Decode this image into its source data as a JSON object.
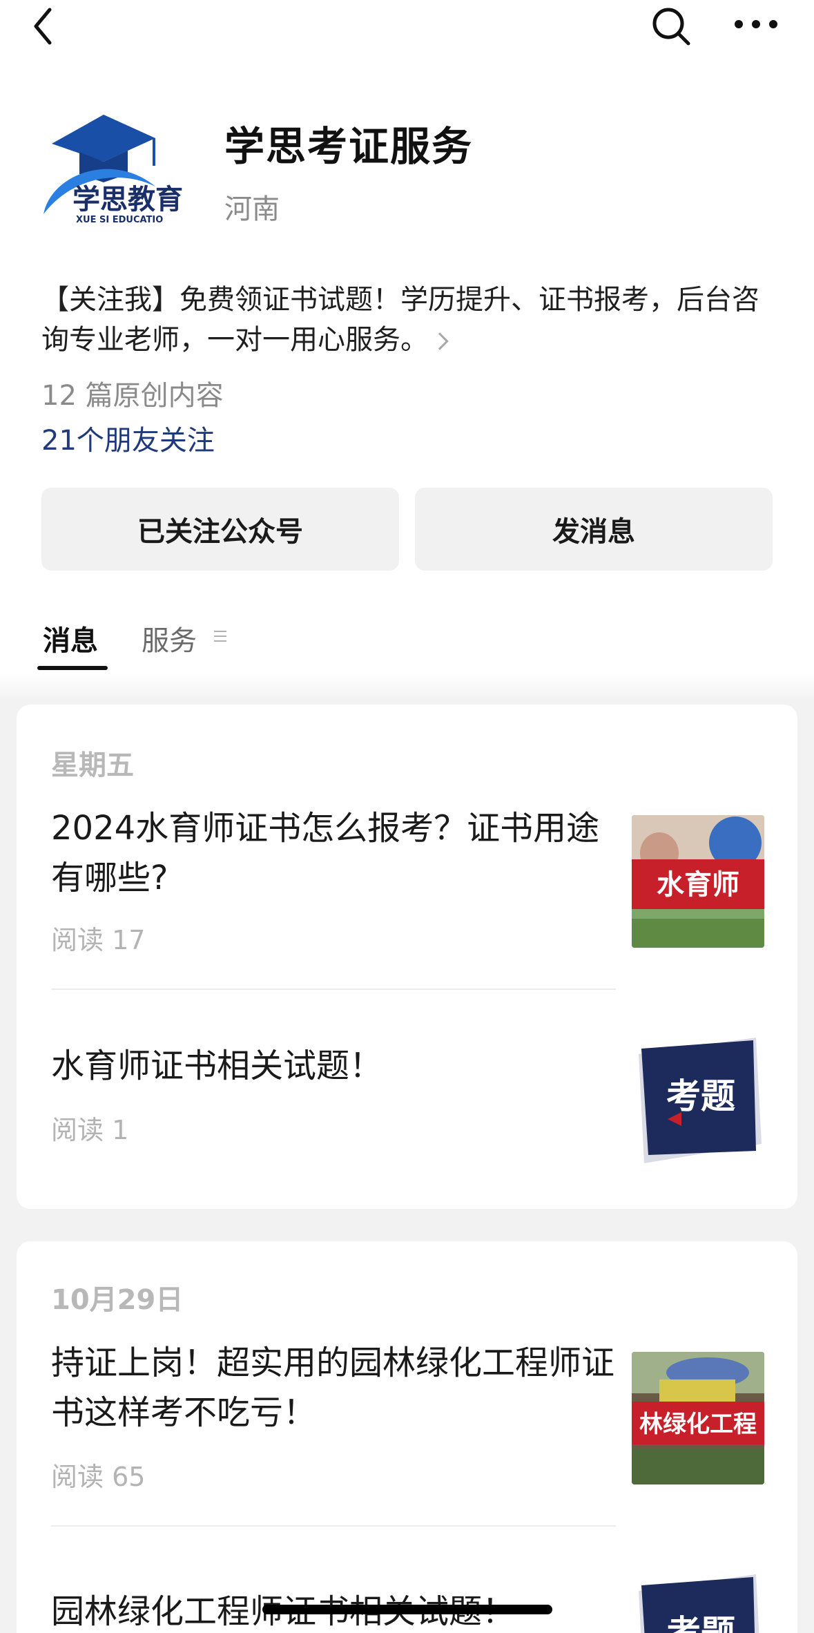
{
  "nav": {
    "back_icon": "chevron-left-icon",
    "search_icon": "search-icon",
    "more_icon": "more-dots-icon"
  },
  "profile": {
    "name": "学思考证服务",
    "region": "河南",
    "logo_text": "学思教育",
    "logo_subtext": "XUE SI EDUCATIO",
    "intro": "【关注我】免费领证书试题！学历提升、证书报考，后台咨询专业老师，一对一用心服务。",
    "original_count": "12 篇原创内容",
    "friends_follow": "21个朋友关注"
  },
  "actions": {
    "followed_label": "已关注公众号",
    "message_label": "发消息"
  },
  "tabs": {
    "messages": "消息",
    "services": "服务"
  },
  "feed": [
    {
      "date": "星期五",
      "articles": [
        {
          "title": "2024水育师证书怎么报考？证书用途有哪些?",
          "reads": "阅读 17",
          "thumb_text": "水育师"
        },
        {
          "title": "水育师证书相关试题！",
          "reads": "阅读 1",
          "thumb_text": "考题"
        }
      ]
    },
    {
      "date": "10月29日",
      "articles": [
        {
          "title": "持证上岗！超实用的园林绿化工程师证书这样考不吃亏！",
          "reads": "阅读 65",
          "thumb_text": "林绿化工程"
        },
        {
          "title": "园林绿化工程师证书相关试题！",
          "reads": "",
          "thumb_text": "考题"
        }
      ]
    }
  ],
  "colors": {
    "link_blue": "#1f3a7a",
    "logo_blue": "#1a4fa8",
    "thumb_red": "#c8202a",
    "thumb_navy": "#1c2a5c"
  }
}
